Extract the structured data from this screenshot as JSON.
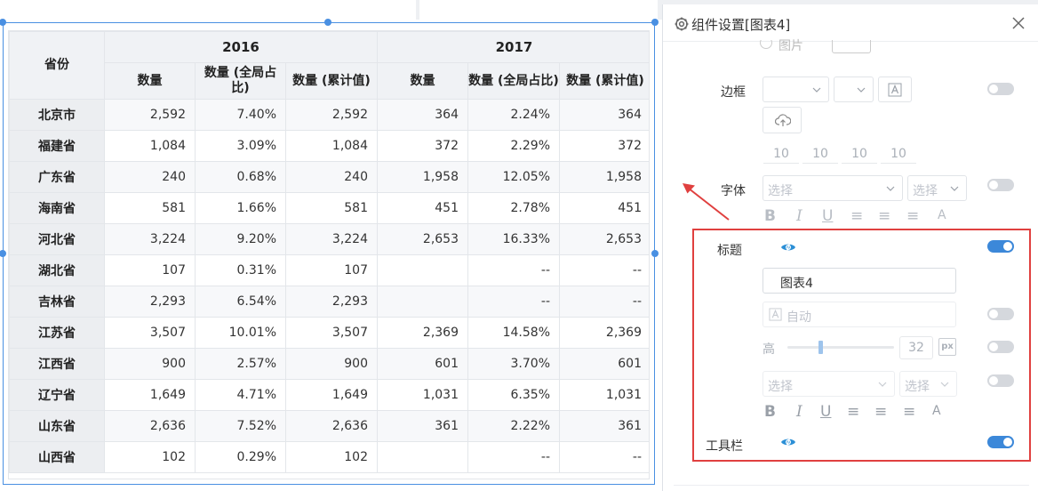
{
  "panel": {
    "title": "组件设置[图表4]",
    "partial_label": "图片",
    "border_label": "边框",
    "font_label": "字体",
    "title_label": "标题",
    "toolbar_label": "工具栏",
    "padding": [
      "10",
      "10",
      "10",
      "10"
    ],
    "select_placeholder": "选择",
    "title_value": "图表4",
    "auto_placeholder": "自动",
    "height_label": "高",
    "height_value": "32",
    "px_label": "px",
    "title_toggle_on": true,
    "toolbar_toggle_on": true
  },
  "table": {
    "header_province": "省份",
    "years": [
      "2016",
      "2017"
    ],
    "subheaders": [
      "数量",
      "数量 (全局占比)",
      "数量 (累计值)",
      "数量",
      "数量 (全局占比)",
      "数量 (累计值)"
    ],
    "rows": [
      {
        "province": "北京市",
        "v": [
          "2,592",
          "7.40%",
          "2,592",
          "364",
          "2.24%",
          "364"
        ]
      },
      {
        "province": "福建省",
        "v": [
          "1,084",
          "3.09%",
          "1,084",
          "372",
          "2.29%",
          "372"
        ]
      },
      {
        "province": "广东省",
        "v": [
          "240",
          "0.68%",
          "240",
          "1,958",
          "12.05%",
          "1,958"
        ]
      },
      {
        "province": "海南省",
        "v": [
          "581",
          "1.66%",
          "581",
          "451",
          "2.78%",
          "451"
        ]
      },
      {
        "province": "河北省",
        "v": [
          "3,224",
          "9.20%",
          "3,224",
          "2,653",
          "16.33%",
          "2,653"
        ]
      },
      {
        "province": "湖北省",
        "v": [
          "107",
          "0.31%",
          "107",
          "",
          "--",
          "--"
        ]
      },
      {
        "province": "吉林省",
        "v": [
          "2,293",
          "6.54%",
          "2,293",
          "",
          "--",
          "--"
        ]
      },
      {
        "province": "江苏省",
        "v": [
          "3,507",
          "10.01%",
          "3,507",
          "2,369",
          "14.58%",
          "2,369"
        ]
      },
      {
        "province": "江西省",
        "v": [
          "900",
          "2.57%",
          "900",
          "601",
          "3.70%",
          "601"
        ]
      },
      {
        "province": "辽宁省",
        "v": [
          "1,649",
          "4.71%",
          "1,649",
          "1,031",
          "6.35%",
          "1,031"
        ]
      },
      {
        "province": "山东省",
        "v": [
          "2,636",
          "7.52%",
          "2,636",
          "361",
          "2.22%",
          "361"
        ]
      },
      {
        "province": "山西省",
        "v": [
          "102",
          "0.29%",
          "102",
          "",
          "--",
          "--"
        ]
      }
    ]
  },
  "colors": {
    "accent": "#3c88d9",
    "highlight_box": "#e0403f",
    "selection": "#4a90e2"
  }
}
